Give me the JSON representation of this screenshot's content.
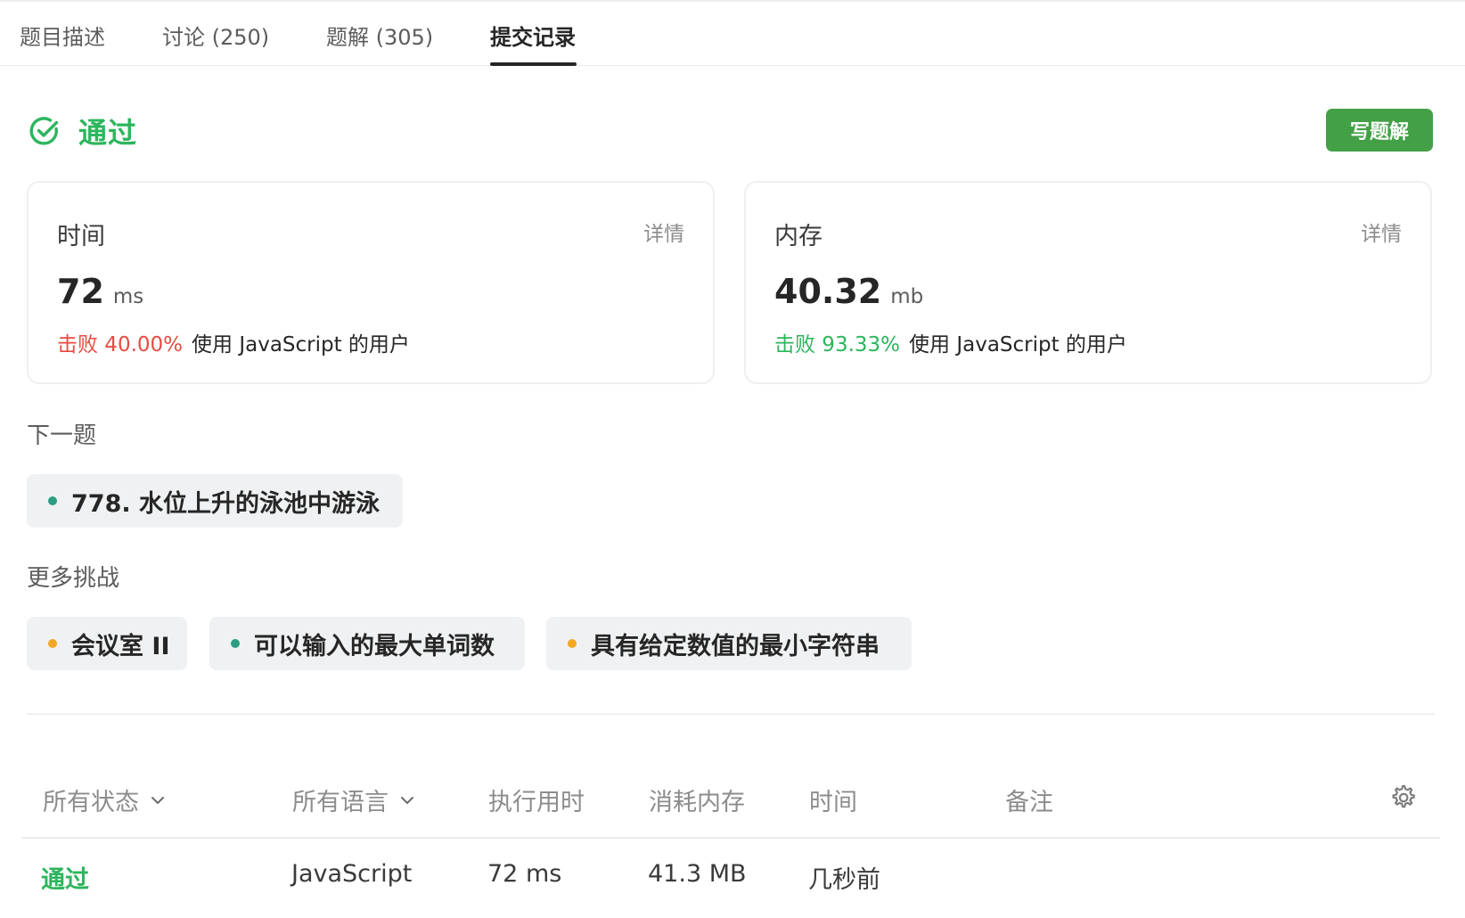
{
  "tabs": [
    {
      "label": "题目描述"
    },
    {
      "label": "讨论 (250)"
    },
    {
      "label": "题解 (305)"
    },
    {
      "label": "提交记录",
      "active": true
    }
  ],
  "status": {
    "label": "通过",
    "icon": "check-circle-icon",
    "color": "#2db55d"
  },
  "write_solution_button": "写题解",
  "time_card": {
    "title": "时间",
    "detail": "详情",
    "value": "72",
    "unit": "ms",
    "beat": "击败 40.00%",
    "beat_color": "#e54d42",
    "beat_suffix": "使用 JavaScript 的用户"
  },
  "memory_card": {
    "title": "内存",
    "detail": "详情",
    "value": "40.32",
    "unit": "mb",
    "beat": "击败 93.33%",
    "beat_color": "#2db55d",
    "beat_suffix": "使用 JavaScript 的用户"
  },
  "next_problem": {
    "label": "下一题",
    "item": {
      "title": "778. 水位上升的泳池中游泳",
      "dot": "#2b9d82"
    }
  },
  "more_challenges": {
    "label": "更多挑战",
    "items": [
      {
        "title": "会议室 II",
        "dot": "#f5a623"
      },
      {
        "title": "可以输入的最大单词数",
        "dot": "#2b9d82"
      },
      {
        "title": "具有给定数值的最小字符串",
        "dot": "#f5a623"
      }
    ]
  },
  "table": {
    "headers": {
      "status": "所有状态",
      "language": "所有语言",
      "runtime": "执行用时",
      "memory": "消耗内存",
      "time": "时间",
      "note": "备注"
    },
    "settings_icon": "gear-icon",
    "rows": [
      {
        "status": "通过",
        "language": "JavaScript",
        "runtime": "72 ms",
        "memory": "41.3 MB",
        "time": "几秒前",
        "note": ""
      }
    ]
  }
}
